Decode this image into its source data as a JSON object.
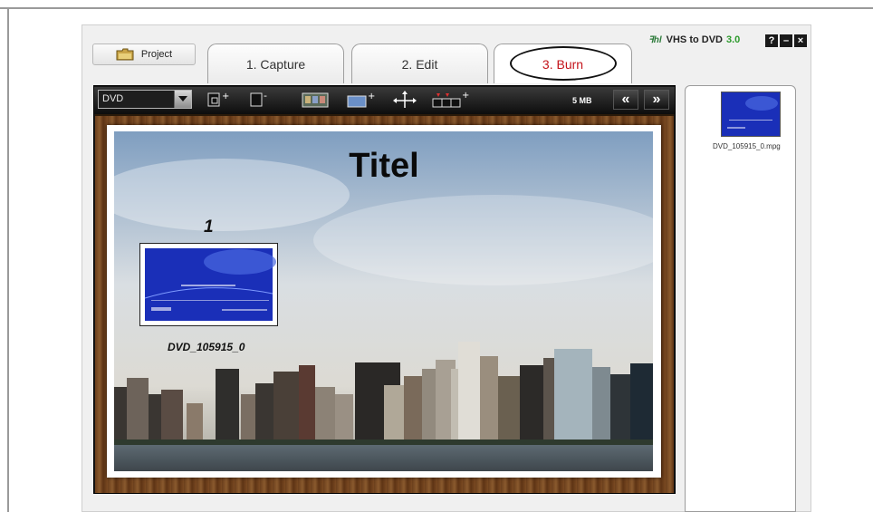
{
  "header": {
    "project_label": "Project",
    "brand_name": "VHS to DVD",
    "brand_version": "3.0",
    "window_buttons": [
      "?",
      "–",
      "×"
    ]
  },
  "tabs": [
    {
      "label": "1. Capture",
      "active": false
    },
    {
      "label": "2. Edit",
      "active": false
    },
    {
      "label": "3. Burn",
      "active": true
    }
  ],
  "toolbar": {
    "format_selected": "DVD",
    "size_label": "5 MB",
    "prev_label": "«",
    "next_label": "»"
  },
  "menu": {
    "title": "Titel",
    "chapter_number": "1",
    "chapter_label": "DVD_105915_0"
  },
  "files": [
    {
      "name": "DVD_105915_0.mpg"
    }
  ],
  "colors": {
    "active_tab_text": "#c4141b",
    "brand_version": "#2c9a2c",
    "toolbar_bg": "#111111",
    "frame_wood": "#7a4a22",
    "thumb_blue": "#1a2fb8"
  }
}
